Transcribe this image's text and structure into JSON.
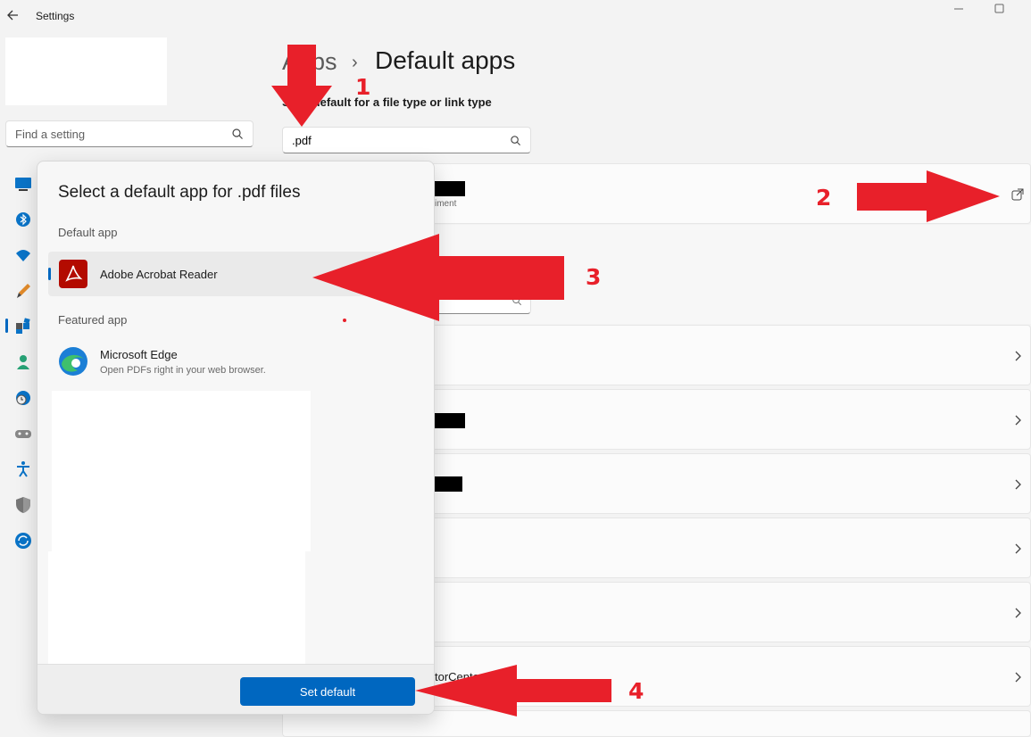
{
  "window": {
    "title": "Settings",
    "back_icon": "arrow-left-icon",
    "minimize_icon": "minimize-icon",
    "maximize_icon": "maximize-icon"
  },
  "sidebar": {
    "search_placeholder": "Find a setting",
    "nav_icons": [
      "system-icon",
      "bluetooth-icon",
      "network-icon",
      "personalization-icon",
      "apps-icon",
      "accounts-icon",
      "time-language-icon",
      "gaming-icon",
      "accessibility-icon",
      "privacy-security-icon",
      "windows-update-icon"
    ],
    "active_index": 4
  },
  "header": {
    "breadcrumb_parent": "Apps",
    "separator": "›",
    "title": "Default apps"
  },
  "filetype": {
    "label": "Set a default for a file type or link type",
    "value": ".pdf"
  },
  "rows": {
    "first_row_subtext": "iment",
    "last_row_fragment": "torCente"
  },
  "dialog": {
    "title": "Select a default app for .pdf files",
    "default_section": "Default app",
    "default_app": {
      "name": "Adobe Acrobat Reader",
      "icon": "adobe-acrobat-icon"
    },
    "featured_section": "Featured app",
    "featured_app": {
      "name": "Microsoft Edge",
      "description": "Open PDFs right in your web browser.",
      "icon": "microsoft-edge-icon"
    },
    "set_default_label": "Set default"
  },
  "annotations": [
    "1",
    "2",
    "3",
    "4"
  ],
  "colors": {
    "accent": "#0067c0",
    "annotation": "#e8202a",
    "pdf_red": "#b30b00"
  }
}
